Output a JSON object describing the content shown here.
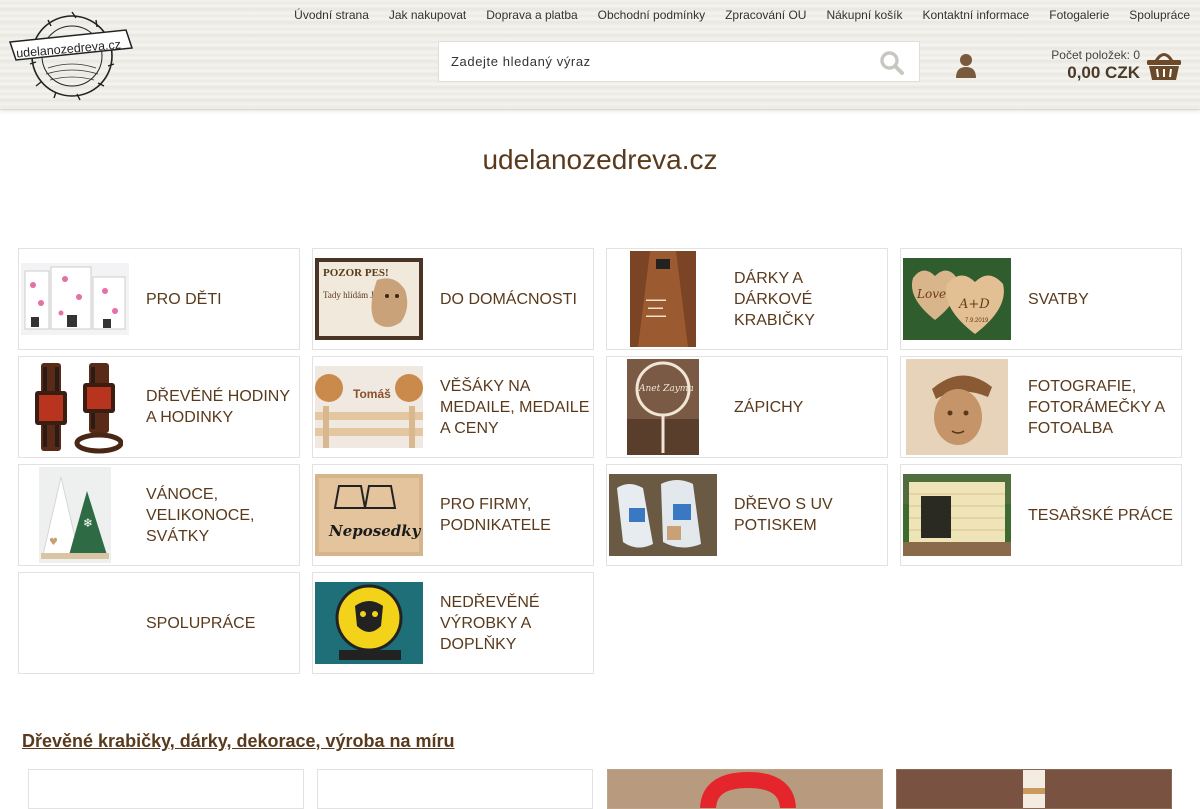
{
  "logo": {
    "text": "udelanozedreva.cz"
  },
  "nav": {
    "items": [
      "Úvodní strana",
      "Jak nakupovat",
      "Doprava a platba",
      "Obchodní podmínky",
      "Zpracování OU",
      "Nákupní košík",
      "Kontaktní informace",
      "Fotogalerie",
      "Spolupráce"
    ]
  },
  "search": {
    "placeholder": "Zadejte hledaný výraz",
    "value": ""
  },
  "icons": {
    "search": "search-icon",
    "user": "user-icon",
    "cart": "basket-icon"
  },
  "cart": {
    "count_label": "Počet položek: 0",
    "total": "0,00 CZK"
  },
  "site_title": "udelanozedreva.cz",
  "categories": [
    {
      "label": "PRO DĚTI",
      "image": "kids-clock-image"
    },
    {
      "label": "DO DOMÁCNOSTI",
      "image": "dog-sign-image",
      "sign_title": "POZOR PES!",
      "sign_text": "Tady hlídám JÁ!"
    },
    {
      "label": "DÁRKY A DÁRKOVÉ KRABIČKY",
      "image": "bottle-opener-image"
    },
    {
      "label": "SVATBY",
      "image": "wedding-hearts-image",
      "heart_left": "Love",
      "heart_right": "A+D",
      "date": "7.9.2019"
    },
    {
      "label": "DŘEVĚNÉ HODINY A HODINKY",
      "image": "wooden-watches-image"
    },
    {
      "label": "VĚŠÁKY NA MEDAILE, MEDAILE A CENY",
      "image": "medal-hanger-image",
      "name": "Tomáš"
    },
    {
      "label": "ZÁPICHY",
      "image": "cake-topper-image",
      "topper_text": "Anet Zayma"
    },
    {
      "label": "FOTOGRAFIE, FOTORÁMEČKY A FOTOALBA",
      "image": "engraved-photo-image"
    },
    {
      "label": "VÁNOCE, VELIKONOCE, SVÁTKY",
      "image": "christmas-trees-image"
    },
    {
      "label": "PRO FIRMY, PODNIKATELE",
      "image": "company-sign-image",
      "sign_text": "Neposedky"
    },
    {
      "label": "DŘEVO S UV POTISKEM",
      "image": "uv-print-image"
    },
    {
      "label": "TESAŘSKÉ PRÁCE",
      "image": "dog-house-image"
    },
    {
      "label": "SPOLUPRÁCE",
      "image": ""
    },
    {
      "label": "NEDŘEVĚNÉ VÝROBKY A DOPLŇKY",
      "image": "yellow-emblem-image"
    }
  ],
  "section_heading": "Dřevěné krabičky, dárky, dekorace, výroba na míru",
  "colors": {
    "brand_brown": "#5a3a1c",
    "border": "#e2e2e2"
  }
}
